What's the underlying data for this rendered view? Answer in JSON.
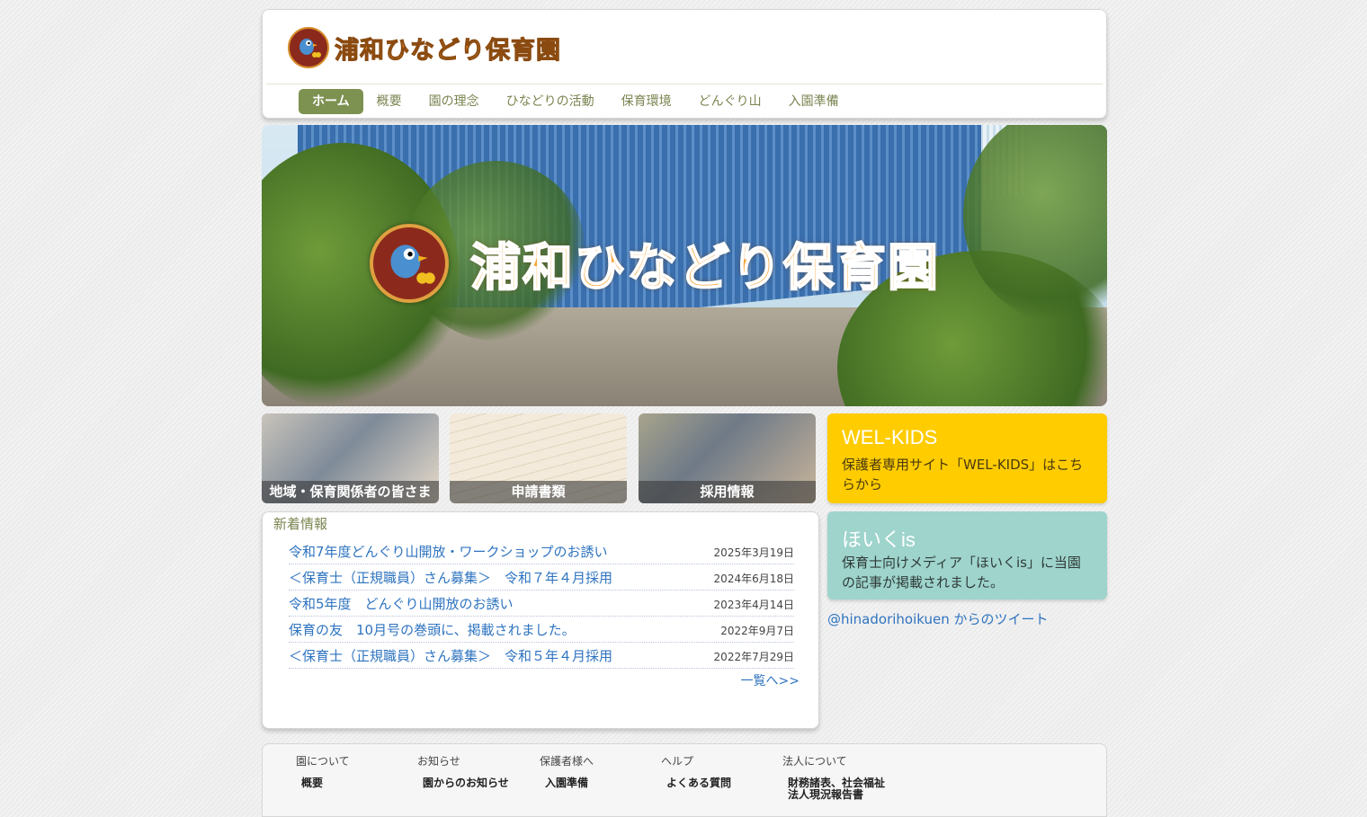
{
  "brand": {
    "name": "浦和ひなどり保育園"
  },
  "nav": {
    "items": [
      {
        "label": "ホーム",
        "active": true
      },
      {
        "label": "概要"
      },
      {
        "label": "園の理念"
      },
      {
        "label": "ひなどりの活動"
      },
      {
        "label": "保育環境"
      },
      {
        "label": "どんぐり山"
      },
      {
        "label": "入園準備"
      }
    ]
  },
  "hero": {
    "title": "浦和ひなどり保育園"
  },
  "tiles": [
    {
      "label": "地域・保育関係者の皆さま"
    },
    {
      "label": "申請書類"
    },
    {
      "label": "採用情報"
    }
  ],
  "news": {
    "heading": "新着情報",
    "items": [
      {
        "title": "令和7年度どんぐり山開放・ワークショップのお誘い",
        "date": "2025年3月19日"
      },
      {
        "title": "＜保育士（正規職員）さん募集＞　令和７年４月採用",
        "date": "2024年6月18日"
      },
      {
        "title": "令和5年度　どんぐり山開放のお誘い",
        "date": "2023年4月14日"
      },
      {
        "title": "保育の友　10月号の巻頭に、掲載されました。",
        "date": "2022年9月7日"
      },
      {
        "title": "＜保育士（正規職員）さん募集＞　令和５年４月採用",
        "date": "2022年7月29日"
      }
    ],
    "more": "一覧へ>>"
  },
  "cards": {
    "welkids": {
      "title": "WEL-KIDS",
      "text": "保護者専用サイト「WEL-KIDS」はこちらから",
      "color": "#ffcc00"
    },
    "hoiku": {
      "title": "ほいくis",
      "text": "保育士向けメディア「ほいくis」に当園の記事が掲載されました。",
      "color": "#9ed4cc"
    }
  },
  "twitter": {
    "label": "@hinadorihoikuen からのツイート"
  },
  "footer": {
    "columns": [
      {
        "heading": "園について",
        "links": [
          "概要"
        ]
      },
      {
        "heading": "お知らせ",
        "links": [
          "園からのお知らせ"
        ]
      },
      {
        "heading": "保護者様へ",
        "links": [
          "入園準備"
        ]
      },
      {
        "heading": "ヘルプ",
        "links": [
          "よくある質問"
        ]
      },
      {
        "heading": "法人について",
        "links": [
          "財務諸表、社会福祉法人現況報告書"
        ]
      }
    ]
  },
  "colors": {
    "nav_active": "#7d9150",
    "link": "#2f74c0",
    "accent_orange": "#f49a2c"
  }
}
